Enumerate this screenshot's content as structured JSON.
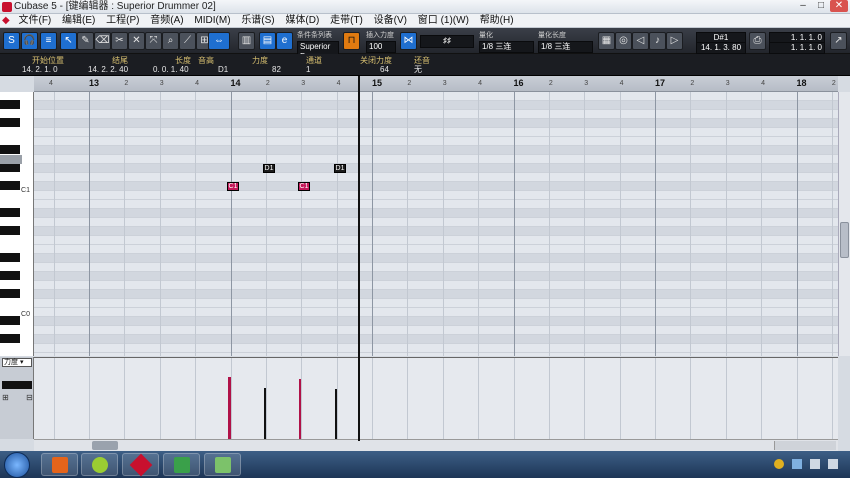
{
  "window": {
    "title": "Cubase 5 - [键编辑器 : Superior Drummer 02]",
    "min_label": "–",
    "max_label": "□",
    "close_label": "✕"
  },
  "menu": [
    "文件(F)",
    "编辑(E)",
    "工程(P)",
    "音频(A)",
    "MIDI(M)",
    "乐谱(S)",
    "媒体(D)",
    "走带(T)",
    "设备(V)",
    "窗口 (1)(W)",
    "帮助(H)"
  ],
  "toolbar": {
    "solo_label": "S",
    "feedback_label": "🎧",
    "kit_label": "条件条列表",
    "kit_value": "Superior D-",
    "insert_vel_label": "插入力度",
    "insert_vel_value": "100",
    "quantize_label": "量化",
    "quantize_value": "1/8 三连",
    "length_label": "量化长度",
    "length_value": "1/8 三连",
    "pos_top": "D#1",
    "pos_bottom": "14. 1. 3. 80",
    "sync_top": "1. 1. 1.  0",
    "sync_bottom": "1. 1. 1.  0"
  },
  "infoline": {
    "labels": [
      "开始位置",
      "结尾",
      "长度",
      "音高",
      "力度",
      "通道",
      "关闭力度",
      "还音"
    ],
    "values": [
      "14. 2. 1.  0",
      "14. 2. 2. 40",
      "0. 0. 1. 40",
      "D1",
      "82",
      "1",
      "64",
      "无"
    ]
  },
  "ruler": {
    "bars": [
      "13",
      "14",
      "15",
      "16",
      "17",
      "18"
    ],
    "beats": [
      "2",
      "3",
      "4"
    ],
    "lead_beat": "4"
  },
  "keyboard": {
    "labels": [
      "C1",
      "C0"
    ]
  },
  "notes": [
    {
      "label": "C1",
      "pitch": "C1"
    },
    {
      "label": "D1",
      "pitch": "D1"
    },
    {
      "label": "C1",
      "pitch": "C1"
    },
    {
      "label": "D1",
      "pitch": "D1"
    }
  ],
  "controller": {
    "lane_label": "力度"
  }
}
